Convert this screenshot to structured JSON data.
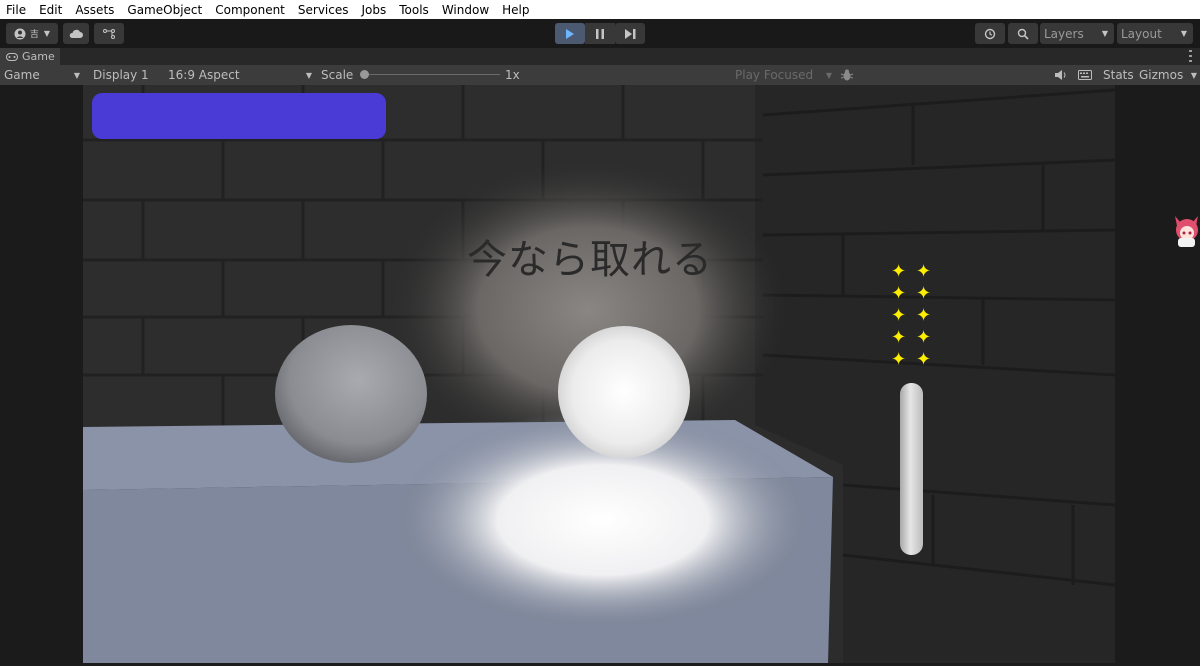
{
  "menu": [
    "File",
    "Edit",
    "Assets",
    "GameObject",
    "Component",
    "Services",
    "Jobs",
    "Tools",
    "Window",
    "Help"
  ],
  "toolbar": {
    "account_icon": "account-icon",
    "account_label": "吉",
    "cloud_icon": "cloud-icon",
    "collab_icon": "collab-icon",
    "play_icon": "play-icon",
    "pause_icon": "pause-icon",
    "step_icon": "step-icon",
    "history_icon": "history-icon",
    "search_icon": "search-icon",
    "layers_label": "Layers",
    "layout_label": "Layout"
  },
  "tab": {
    "label": "Game"
  },
  "game_controls": {
    "mode": "Game",
    "display": "Display 1",
    "aspect": "16:9 Aspect",
    "scale_label": "Scale",
    "scale_value": "1x",
    "play_focused": "Play Focused",
    "stats": "Stats",
    "gizmos": "Gizmos"
  },
  "scene": {
    "wall_text": "今なら取れる",
    "health_color": "#4a3bd6",
    "sparkle_count": 10,
    "sparkle_color": "#ffee00"
  }
}
